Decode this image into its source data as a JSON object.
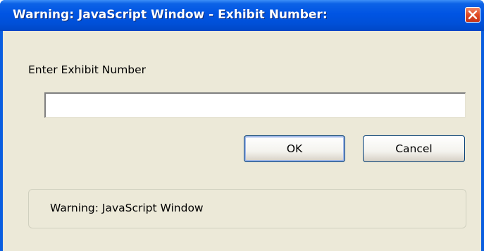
{
  "window": {
    "title": "Warning: JavaScript Window - Exhibit Number:",
    "close_icon": "close-icon"
  },
  "prompt": {
    "label": "Enter Exhibit Number",
    "input_value": ""
  },
  "buttons": {
    "ok_label": "OK",
    "cancel_label": "Cancel"
  },
  "status": {
    "text": "Warning: JavaScript Window"
  },
  "colors": {
    "titlebar": "#0054e3",
    "client": "#ece9d8",
    "close_button": "#e04a23"
  }
}
